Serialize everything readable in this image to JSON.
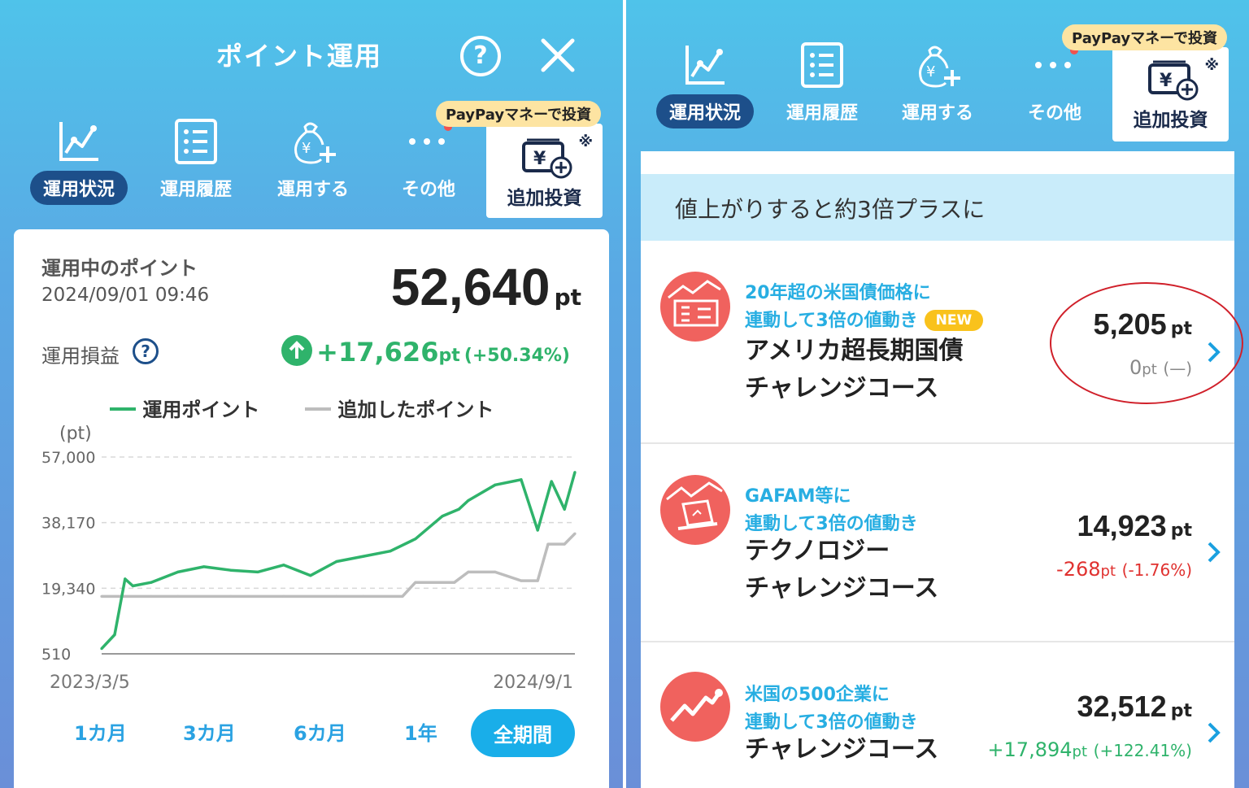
{
  "left": {
    "title": "ポイント運用",
    "help_glyph": "?",
    "nav": [
      {
        "label": "運用状況",
        "icon": "chart-line-icon",
        "active": true
      },
      {
        "label": "運用履歴",
        "icon": "list-icon",
        "active": false
      },
      {
        "label": "運用する",
        "icon": "money-bag-plus-icon",
        "active": false
      },
      {
        "label": "その他",
        "icon": "more-dots-icon",
        "active": false
      }
    ],
    "add_invest": {
      "pill": "PayPayマネーで投資",
      "label": "追加投資",
      "mark": "※"
    },
    "summary": {
      "label": "運用中のポイント",
      "datetime": "2024/09/01 09:46",
      "value": "52,640",
      "unit": "pt",
      "pl_label": "運用損益",
      "pl_value": "+17,626",
      "pl_unit": "pt",
      "pl_pct": "(+50.34%)"
    },
    "legend": {
      "series1": "運用ポイント",
      "series2": "追加したポイント"
    },
    "axis_unit": "(pt)",
    "periods": [
      "1カ月",
      "3カ月",
      "6カ月",
      "1年",
      "全期間"
    ],
    "active_period": "全期間"
  },
  "chart_data": {
    "type": "line",
    "x_start": "2023/3/5",
    "x_end": "2024/9/1",
    "ylabel": "(pt)",
    "yticks": [
      "57,000",
      "38,170",
      "19,340",
      "510"
    ],
    "ylim": [
      510,
      57000
    ],
    "grid": true,
    "legend_position": "top",
    "series": [
      {
        "name": "運用ポイント",
        "color": "#2fb36b",
        "x": [
          "2023/3/5",
          "2023/3/20",
          "2023/4/1",
          "2023/4/10",
          "2023/5/1",
          "2023/6/1",
          "2023/7/1",
          "2023/8/1",
          "2023/9/1",
          "2023/10/1",
          "2023/11/1",
          "2023/12/1",
          "2024/1/1",
          "2024/2/1",
          "2024/3/1",
          "2024/4/1",
          "2024/4/20",
          "2024/5/1",
          "2024/6/1",
          "2024/7/1",
          "2024/7/20",
          "2024/8/5",
          "2024/8/20",
          "2024/9/1"
        ],
        "values": [
          2000,
          6000,
          22000,
          20000,
          21000,
          24000,
          25500,
          24500,
          24000,
          26000,
          23000,
          27000,
          28500,
          30000,
          33500,
          40000,
          42000,
          44500,
          49000,
          50500,
          36000,
          50000,
          42000,
          52640
        ]
      },
      {
        "name": "追加したポイント",
        "color": "#bdbdbd",
        "x": [
          "2023/3/5",
          "2023/4/1",
          "2023/5/1",
          "2023/6/1",
          "2023/8/1",
          "2023/10/1",
          "2023/12/1",
          "2024/1/1",
          "2024/2/15",
          "2024/3/1",
          "2024/4/15",
          "2024/5/1",
          "2024/6/1",
          "2024/7/1",
          "2024/7/20",
          "2024/8/1",
          "2024/8/20",
          "2024/9/1"
        ],
        "values": [
          17000,
          17000,
          17000,
          17000,
          17000,
          17000,
          17000,
          17000,
          17000,
          21000,
          21000,
          24000,
          24000,
          21500,
          21500,
          32000,
          32000,
          35000
        ]
      }
    ]
  },
  "right": {
    "nav": [
      {
        "label": "運用状況",
        "icon": "chart-line-icon",
        "active": true
      },
      {
        "label": "運用履歴",
        "icon": "list-icon",
        "active": false
      },
      {
        "label": "運用する",
        "icon": "money-bag-plus-icon",
        "active": false
      },
      {
        "label": "その他",
        "icon": "more-dots-icon",
        "active": false
      }
    ],
    "add_invest": {
      "pill": "PayPayマネーで投資",
      "label": "追加投資",
      "mark": "※"
    },
    "banner": "値上がりすると約3倍プラスに",
    "courses": [
      {
        "icon": "bond-building-icon",
        "sub": [
          "20年超の米国債価格に",
          "連動して3倍の値動き"
        ],
        "badge": "NEW",
        "name": [
          "アメリカ超長期国債",
          "チャレンジコース"
        ],
        "value": "5,205",
        "unit": "pt",
        "delta": "0",
        "delta_unit": "pt",
        "delta_pct": "(—)",
        "delta_color": "#888888"
      },
      {
        "icon": "laptop-chart-icon",
        "sub": [
          "GAFAM等に",
          "連動して3倍の値動き"
        ],
        "badge": "",
        "name": [
          "テクノロジー",
          "チャレンジコース"
        ],
        "value": "14,923",
        "unit": "pt",
        "delta": "-268",
        "delta_unit": "pt",
        "delta_pct": "(-1.76%)",
        "delta_color": "#e0312f"
      },
      {
        "icon": "trend-up-icon",
        "sub": [
          "米国の500企業に",
          "連動して3倍の値動き"
        ],
        "badge": "",
        "name": [
          "チャレンジコース"
        ],
        "value": "32,512",
        "unit": "pt",
        "delta": "+17,894",
        "delta_unit": "pt",
        "delta_pct": "(+122.41%)",
        "delta_color": "#2fb36b"
      }
    ]
  }
}
